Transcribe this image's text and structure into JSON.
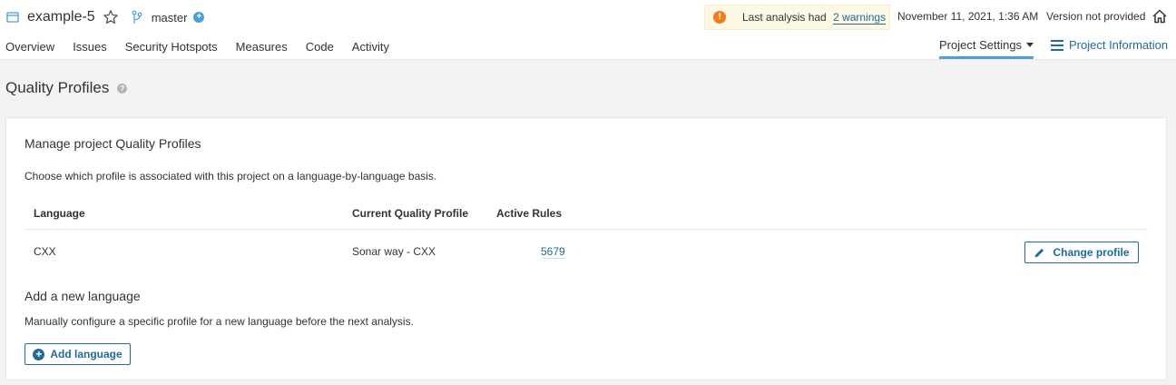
{
  "header": {
    "project_name": "example-5",
    "branch": "master",
    "warning_prefix": "Last analysis had",
    "warning_link": "2 warnings",
    "analysis_date": "November 11, 2021, 1:36 AM",
    "version": "Version not provided"
  },
  "nav": {
    "items": [
      "Overview",
      "Issues",
      "Security Hotspots",
      "Measures",
      "Code",
      "Activity"
    ],
    "settings": "Project Settings",
    "info": "Project Information"
  },
  "page": {
    "title": "Quality Profiles"
  },
  "card": {
    "title": "Manage project Quality Profiles",
    "description": "Choose which profile is associated with this project on a language-by-language basis.",
    "columns": {
      "language": "Language",
      "profile": "Current Quality Profile",
      "rules": "Active Rules"
    },
    "rows": [
      {
        "language": "CXX",
        "profile": "Sonar way - CXX",
        "rules": "5679",
        "action": "Change profile"
      }
    ],
    "add_title": "Add a new language",
    "add_description": "Manually configure a specific profile for a new language before the next analysis.",
    "add_button": "Add language"
  },
  "colors": {
    "accent": "#236a97",
    "tab_underline": "#4b9fd5",
    "warning_bg": "#fcf8e3",
    "warning_icon": "#ed7d20"
  },
  "icons": {
    "project": "project-icon",
    "favorite": "star-icon",
    "branch": "branch-icon",
    "warning": "warning-icon",
    "home": "home-icon",
    "info": "list-icon",
    "help": "help-icon",
    "edit": "pencil-icon",
    "add": "plus-circle-icon"
  }
}
